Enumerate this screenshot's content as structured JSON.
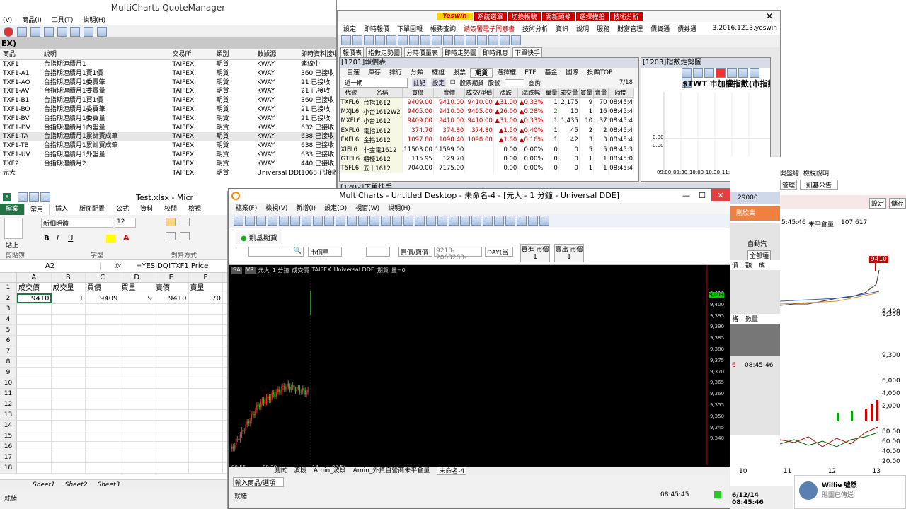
{
  "quote_manager": {
    "title": "MultiCharts QuoteManager",
    "menu": [
      "(V)",
      "商品(I)",
      "工具(T)",
      "說明(H)"
    ],
    "header_label": "EX)",
    "columns": [
      "商品",
      "說明",
      "交易所",
      "類別",
      "數據源",
      "即時資料接收"
    ],
    "rows": [
      [
        "TXF1",
        "台指期連續月1",
        "TAIFEX",
        "期貨",
        "KWAY",
        "連線中"
      ],
      [
        "TXF1-A1",
        "台指期連續月1賣1價",
        "TAIFEX",
        "期貨",
        "KWAY",
        "360 已接收"
      ],
      [
        "TXF1-AO",
        "台指期連續月1委賣筆",
        "TAIFEX",
        "期貨",
        "KWAY",
        "21 已接收"
      ],
      [
        "TXF1-AV",
        "台指期連續月1委賣量",
        "TAIFEX",
        "期貨",
        "KWAY",
        "21 已接收"
      ],
      [
        "TXF1-B1",
        "台指期連續月1買1價",
        "TAIFEX",
        "期貨",
        "KWAY",
        "360 已接收"
      ],
      [
        "TXF1-BO",
        "台指期連續月1委買筆",
        "TAIFEX",
        "期貨",
        "KWAY",
        "21 已接收"
      ],
      [
        "TXF1-BV",
        "台指期連續月1委買量",
        "TAIFEX",
        "期貨",
        "KWAY",
        "21 已接收"
      ],
      [
        "TXF1-DV",
        "台指期連續月1內盤量",
        "TAIFEX",
        "期貨",
        "KWAY",
        "632 已接收"
      ],
      [
        "TXF1-TA",
        "台指期連續月1累計賣成筆",
        "TAIFEX",
        "期貨",
        "KWAY",
        "638 已接收"
      ],
      [
        "TXF1-TB",
        "台指期連續月1累計買成筆",
        "TAIFEX",
        "期貨",
        "KWAY",
        "638 已接收"
      ],
      [
        "TXF1-UV",
        "台指期連續月1外盤量",
        "TAIFEX",
        "期貨",
        "KWAY",
        "633 已接收"
      ],
      [
        "TXF2",
        "台指期連續月2",
        "TAIFEX",
        "期貨",
        "KWAY",
        "440 已接收"
      ],
      [
        "元大",
        "",
        "TAIFEX",
        "期貨",
        "Universal DDE",
        "1068 已接收"
      ]
    ]
  },
  "excel": {
    "title": "Test.xlsx - Micr",
    "tabs": [
      "檔案",
      "常用",
      "插入",
      "版面配置",
      "公式",
      "資料",
      "校閱",
      "檢視"
    ],
    "font_name": "新細明體",
    "font_size": "12",
    "groups": [
      "剪貼簿",
      "字型",
      "對齊方式"
    ],
    "paste_label": "貼上",
    "name_box": "A2",
    "formula": "=YESIDQ!TXF1.Price",
    "col_headers": [
      "A",
      "B",
      "C",
      "D",
      "E",
      "F"
    ],
    "row1": [
      "成交價",
      "成交量",
      "買價",
      "買量",
      "賣價",
      "賣量"
    ],
    "row2": [
      "9410",
      "1",
      "9409",
      "9",
      "9410",
      "70"
    ],
    "row_numbers": [
      "1",
      "2",
      "3",
      "4",
      "5",
      "6",
      "7",
      "8",
      "9",
      "10",
      "11",
      "12",
      "13",
      "14",
      "15",
      "16",
      "17",
      "18"
    ],
    "sheets": [
      "Sheet1",
      "Sheet2",
      "Sheet3"
    ],
    "status": "就緒"
  },
  "yeswin": {
    "brand": "Yeswin",
    "top_buttons": [
      "系統選單",
      "切換帳號",
      "閱新頭條",
      "選擇權盤",
      "技術分析"
    ],
    "menu": [
      "設定",
      "即時報價",
      "下單回報",
      "帳務查詢",
      "請簽署電子同意書",
      "技術分析",
      "資訊",
      "說明",
      "服務",
      "財富管理",
      "債資通",
      "債券通"
    ],
    "version": "3.2016.1213.yeswin",
    "subtabs": [
      "報價表",
      "指數走勢圖",
      "分時價量表",
      "即時走勢圖",
      "即時訊息",
      "下單快手"
    ],
    "quote_panel_title": "[1201]報價表",
    "quote_tabs": [
      "自選",
      "庫存",
      "排行",
      "分類",
      "權證",
      "股票",
      "期貨",
      "選擇權",
      "ETF",
      "基金",
      "國際",
      "投顧TOP"
    ],
    "period": "近一期",
    "period_buttons": [
      "註記",
      "設定"
    ],
    "stock_futures_label": "股票期貨",
    "stock_label": "股號",
    "query_label": "查詢",
    "page": "7/18",
    "columns": [
      "代號",
      "名稱",
      "買價",
      "賣價",
      "成交/淨值",
      "漲跌",
      "漲跌幅",
      "單量",
      "成交量",
      "買量",
      "賣量",
      "時間"
    ],
    "rows": [
      [
        "TXFL6",
        "台指1612",
        "9409.00",
        "9410.00",
        "9410.00",
        "▲31.00",
        "▲0.33%",
        "1",
        "2,175",
        "9",
        "70",
        "08:45:4"
      ],
      [
        "MXJL6",
        "小台1612W2",
        "9405.00",
        "9410.00",
        "9405.00",
        "▲26.00",
        "▲0.28%",
        "2",
        "10",
        "1",
        "16",
        "08:45:4"
      ],
      [
        "MXFL6",
        "小台1612",
        "9409.00",
        "9410.00",
        "9410.00",
        "▲31.00",
        "▲0.33%",
        "1",
        "1,435",
        "10",
        "37",
        "08:45:4"
      ],
      [
        "EXFL6",
        "電指1612",
        "374.70",
        "374.80",
        "374.80",
        "▲1.50",
        "▲0.40%",
        "1",
        "45",
        "2",
        "2",
        "08:45:4"
      ],
      [
        "FXFL6",
        "金指1612",
        "1097.80",
        "1098.40",
        "1098.00",
        "▲1.80",
        "▲0.16%",
        "1",
        "42",
        "3",
        "3",
        "08:45:4"
      ],
      [
        "XIFL6",
        "非金電1612",
        "11503.00",
        "11599.00",
        "",
        "0.00",
        "0.00%",
        "0",
        "0",
        "5",
        "5",
        "08:45:3"
      ],
      [
        "GTFL6",
        "櫃檯1612",
        "115.95",
        "129.70",
        "",
        "0.00",
        "0.00%",
        "0",
        "0",
        "1",
        "1",
        "08:45:0"
      ],
      [
        "T5FL6",
        "五十1612",
        "7040.00",
        "7175.00",
        "",
        "0.00",
        "0.00%",
        "0",
        "0",
        "1",
        "1",
        "08:45:4"
      ]
    ],
    "index_panel_title": "[1203]指數走勢圖",
    "index_title": "$TWT 市加權指數(市指數",
    "index_y": [
      "0.00",
      "0.00"
    ],
    "index_x": [
      "09:00",
      "09:30",
      "10:00",
      "10:30",
      "11:00",
      "11:30",
      "12:00"
    ],
    "bottom_panel_title": "[1202]下單快手"
  },
  "multicharts": {
    "title": "MultiCharts - Untitled Desktop - 未命名-4 - [元大 - 1 分鐘 - Universal DDE]",
    "menu": [
      "檔案(F)",
      "檢視(V)",
      "新增(I)",
      "設定(O)",
      "視窗(W)",
      "說明(H)"
    ],
    "tab": "凱基期貨",
    "market_select": "市價單",
    "price_select": "買價/賣價",
    "account_select": "9218-2003283-",
    "day_select": "DAY(當",
    "buy_button": [
      "買進 市價",
      "1"
    ],
    "sell_button": [
      "賣出 市價",
      "1"
    ],
    "chart_header": [
      "SA",
      "VR",
      "元大",
      "1 分鐘",
      "成交價",
      "TAIFEX",
      "Universal DDE",
      "期貨",
      "量=0"
    ],
    "price_labels": [
      "9,410",
      "9,400",
      "9,395",
      "9,390",
      "9,385",
      "9,380",
      "9,375",
      "9,370",
      "9,365",
      "9,360",
      "9,355",
      "9,350",
      "9,345",
      "9,340"
    ],
    "last_price": "9,409",
    "time_labels": [
      "08:55",
      "09:20",
      "14",
      "08:54"
    ],
    "sheet_tabs": [
      "測試",
      "波段",
      "Amin_波段",
      "Amin_外資自營商未平倉量",
      "未命名-4"
    ],
    "symbol_input": "輸入商品/選項",
    "status_left": "就緒",
    "status_time": "08:45:45"
  },
  "right_panel": {
    "menu": [
      "開盤總",
      "檢視說明"
    ],
    "tabs": [
      "管理",
      "凱基公告"
    ],
    "number_29000": "29000",
    "sidebar_label": "剛欣業",
    "auto_label": "自動汽",
    "all_label": "全部種",
    "price_labels": [
      "價",
      "額",
      "成"
    ],
    "time_info": "5:45:46",
    "unclosed_label": "未平倉量",
    "unclosed_value": "107,617",
    "settings_buttons": [
      "設定",
      "儲存"
    ],
    "price_9410": "9410",
    "axis": [
      "9,400",
      "9,350",
      "9,300"
    ],
    "vol_axis": [
      "6,000",
      "4,000",
      "2,000"
    ],
    "osc_axis": [
      "80.00",
      "60.00",
      "40.00",
      "20.00"
    ],
    "small_labels": [
      "格",
      "數量"
    ],
    "time2": "08:45:46",
    "x_dates": [
      "10",
      "11",
      "12",
      "13"
    ],
    "bottom_time": "6/12/14 08:45:46",
    "chat_name": "Willie 噓然",
    "chat_text": "貼圖已傳送"
  }
}
